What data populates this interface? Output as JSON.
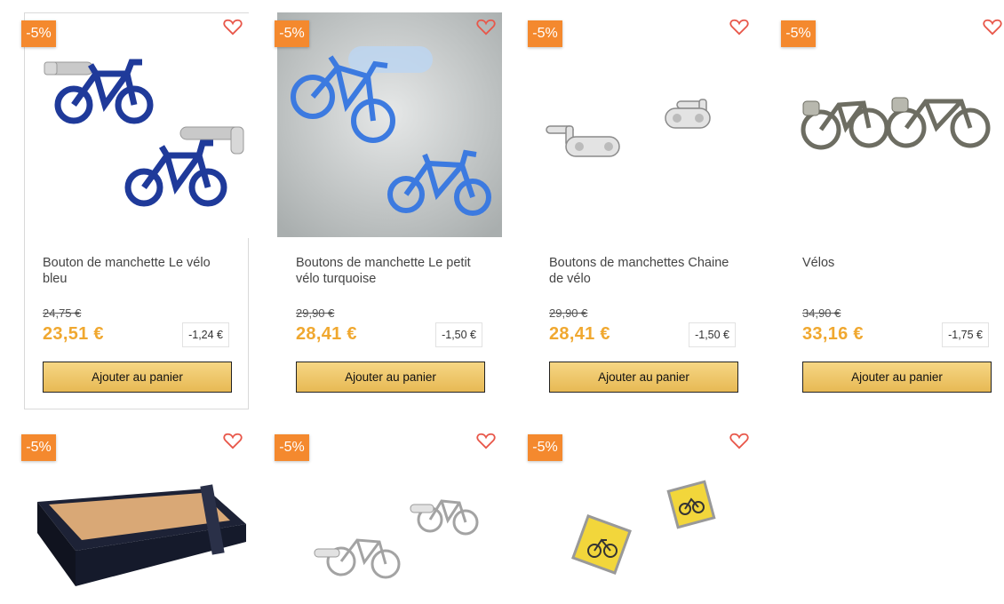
{
  "products": [
    {
      "badge": "-5%",
      "title": "Bouton de manchette Le vélo bleu",
      "old_price": "24,75 €",
      "price": "23,51 €",
      "discount": "-1,24 €",
      "cart_label": "Ajouter au panier"
    },
    {
      "badge": "-5%",
      "title": "Boutons de manchette Le petit vélo turquoise",
      "old_price": "29,90 €",
      "price": "28,41 €",
      "discount": "-1,50 €",
      "cart_label": "Ajouter au panier"
    },
    {
      "badge": "-5%",
      "title": "Boutons de manchettes Chaine de vélo",
      "old_price": "29,90 €",
      "price": "28,41 €",
      "discount": "-1,50 €",
      "cart_label": "Ajouter au panier"
    },
    {
      "badge": "-5%",
      "title": "Vélos",
      "old_price": "34,90 €",
      "price": "33,16 €",
      "discount": "-1,75 €",
      "cart_label": "Ajouter au panier"
    },
    {
      "badge": "-5%"
    },
    {
      "badge": "-5%"
    },
    {
      "badge": "-5%"
    }
  ],
  "icons": {
    "wishlist": "heart-outline-icon"
  },
  "colors": {
    "badge": "#f4892e",
    "price": "#f0a830",
    "heart": "#e8574a",
    "button_top": "#f6d684",
    "button_bottom": "#e7b954"
  }
}
